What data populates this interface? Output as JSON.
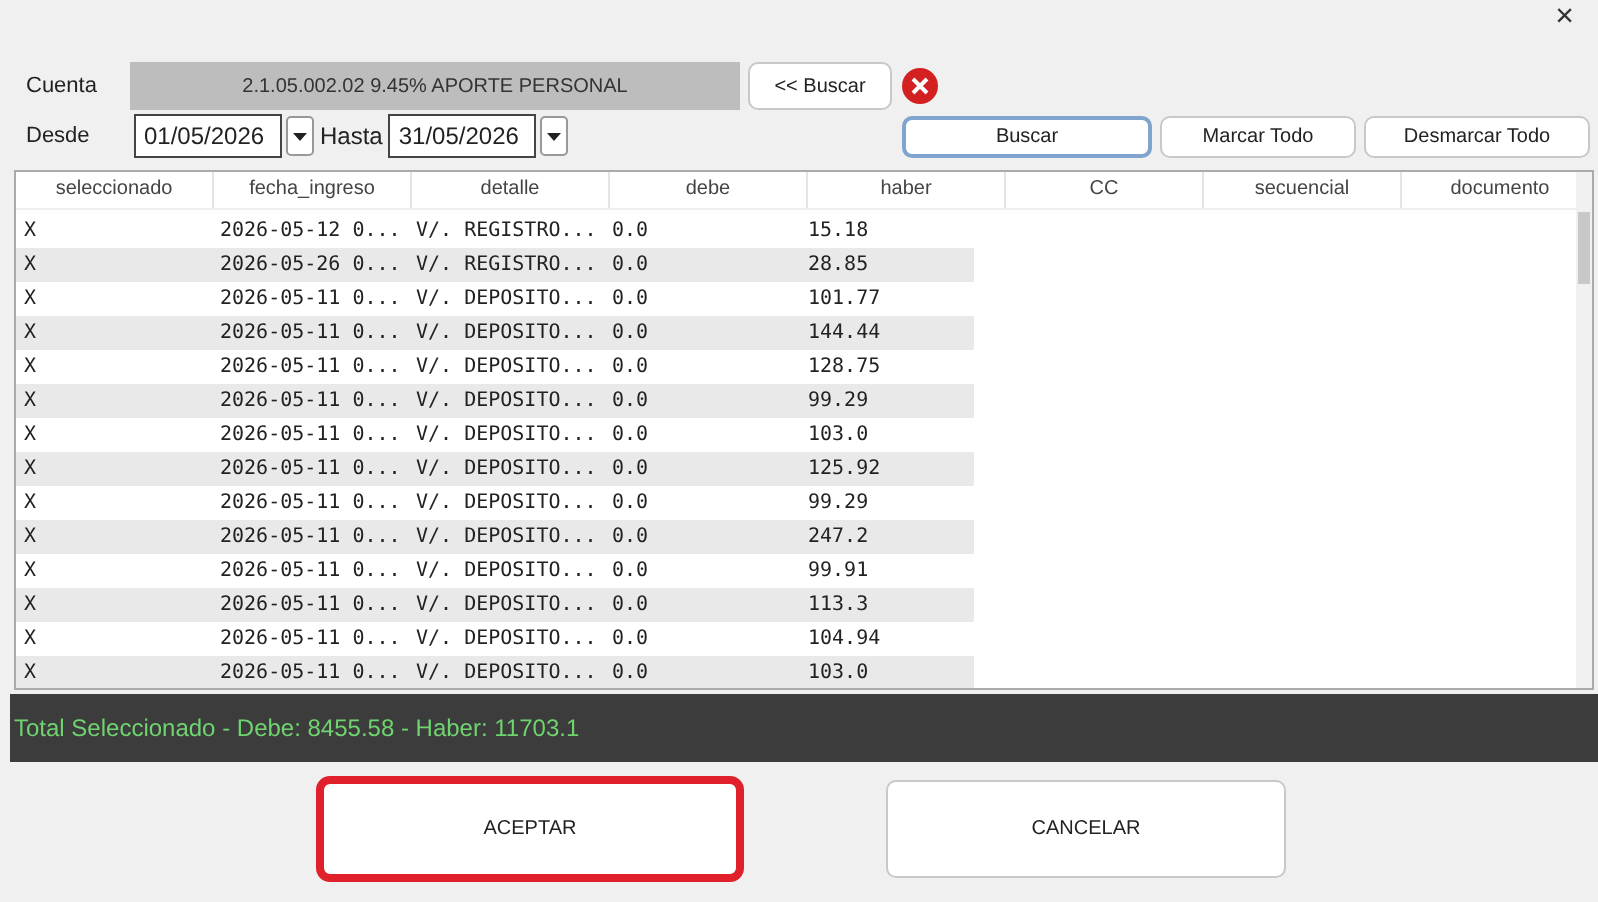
{
  "close_button": "×",
  "cuenta": {
    "label": "Cuenta",
    "value": "2.1.05.002.02  9.45% APORTE PERSONAL",
    "search_button": "<< Buscar"
  },
  "desde": {
    "label": "Desde",
    "value": "01/05/2026"
  },
  "hasta": {
    "label": "Hasta",
    "value": "31/05/2026"
  },
  "actions": [
    {
      "label": "Buscar",
      "focused": true
    },
    {
      "label": "Marcar Todo",
      "focused": false
    },
    {
      "label": "Desmarcar Todo",
      "focused": false
    }
  ],
  "table": {
    "columns": [
      "seleccionado",
      "fecha_ingreso",
      "detalle",
      "debe",
      "haber",
      "CC",
      "secuencial",
      "documento"
    ],
    "rows": [
      [
        "X",
        "2026-05-12 0...",
        "V/. REGISTRO...",
        "0.0",
        "15.18"
      ],
      [
        "X",
        "2026-05-26 0...",
        "V/. REGISTRO...",
        "0.0",
        "28.85"
      ],
      [
        "X",
        "2026-05-11 0...",
        "V/. DEPOSITO...",
        "0.0",
        "101.77"
      ],
      [
        "X",
        "2026-05-11 0...",
        "V/. DEPOSITO...",
        "0.0",
        "144.44"
      ],
      [
        "X",
        "2026-05-11 0...",
        "V/. DEPOSITO...",
        "0.0",
        "128.75"
      ],
      [
        "X",
        "2026-05-11 0...",
        "V/. DEPOSITO...",
        "0.0",
        "99.29"
      ],
      [
        "X",
        "2026-05-11 0...",
        "V/. DEPOSITO...",
        "0.0",
        "103.0"
      ],
      [
        "X",
        "2026-05-11 0...",
        "V/. DEPOSITO...",
        "0.0",
        "125.92"
      ],
      [
        "X",
        "2026-05-11 0...",
        "V/. DEPOSITO...",
        "0.0",
        "99.29"
      ],
      [
        "X",
        "2026-05-11 0...",
        "V/. DEPOSITO...",
        "0.0",
        "247.2"
      ],
      [
        "X",
        "2026-05-11 0...",
        "V/. DEPOSITO...",
        "0.0",
        "99.91"
      ],
      [
        "X",
        "2026-05-11 0...",
        "V/. DEPOSITO...",
        "0.0",
        "113.3"
      ],
      [
        "X",
        "2026-05-11 0...",
        "V/. DEPOSITO...",
        "0.0",
        "104.94"
      ],
      [
        "X",
        "2026-05-11 0...",
        "V/. DEPOSITO...",
        "0.0",
        "103.0"
      ]
    ]
  },
  "status_bar": "Total Seleccionado - Debe: 8455.58 - Haber: 11703.1",
  "footer_buttons": [
    {
      "label": "ACEPTAR",
      "highlighted": true
    },
    {
      "label": "CANCELAR",
      "highlighted": false
    }
  ]
}
